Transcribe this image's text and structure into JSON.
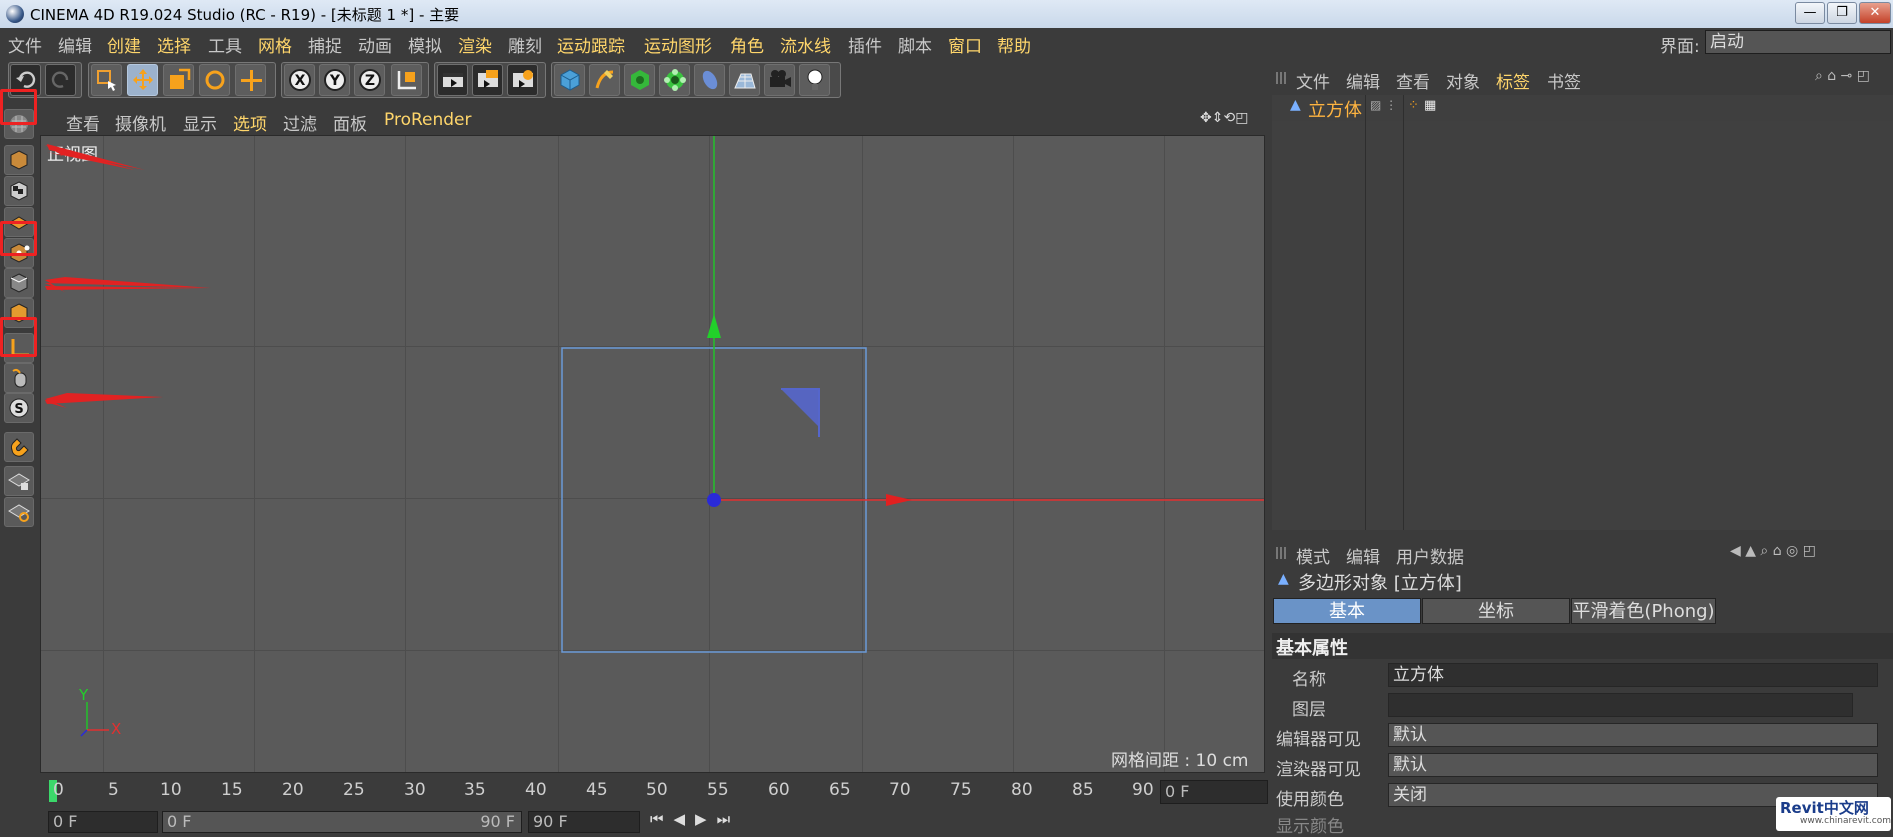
{
  "window": {
    "title": "CINEMA 4D R19.024 Studio (RC - R19) - [未标题 1 *] - 主要",
    "min": "—",
    "max": "❐",
    "close": "✕"
  },
  "menubar": {
    "items": [
      "文件",
      "编辑",
      "创建",
      "选择",
      "工具",
      "网格",
      "捕捉",
      "动画",
      "模拟",
      "渲染",
      "雕刻",
      "运动跟踪",
      "运动图形",
      "角色",
      "流水线",
      "插件",
      "脚本",
      "窗口",
      "帮助"
    ],
    "layout_label": "界面:",
    "layout_value": "启动"
  },
  "viewport": {
    "menu": [
      "查看",
      "摄像机",
      "显示",
      "选项",
      "过滤",
      "面板",
      "ProRender"
    ],
    "name": "正视图",
    "grid_spacing": "网格间距 : 10 cm",
    "axis_y": "Y",
    "axis_x": "X"
  },
  "timeline": {
    "ticks": [
      "0",
      "5",
      "10",
      "15",
      "20",
      "25",
      "30",
      "35",
      "40",
      "45",
      "50",
      "55",
      "60",
      "65",
      "70",
      "75",
      "80",
      "85",
      "90"
    ],
    "frame_field": "0 F"
  },
  "bottombar": {
    "start": "0 F",
    "range_start": "0 F",
    "range_end": "90 F",
    "end": "90 F"
  },
  "objmanager": {
    "menu": [
      "文件",
      "编辑",
      "查看",
      "对象",
      "标签",
      "书签"
    ],
    "object_name": "立方体"
  },
  "attrmanager": {
    "menu": [
      "模式",
      "编辑",
      "用户数据"
    ],
    "object_title": "多边形对象 [立方体]",
    "tabs": [
      "基本",
      "坐标",
      "平滑着色(Phong)"
    ],
    "section": "基本属性",
    "props": [
      {
        "label": "名称",
        "value": "立方体"
      },
      {
        "label": "图层",
        "value": ""
      },
      {
        "label": "编辑器可见",
        "value": "默认"
      },
      {
        "label": "渲染器可见",
        "value": "默认"
      },
      {
        "label": "使用颜色",
        "value": "关闭"
      },
      {
        "label": "显示颜色",
        "value": ""
      }
    ]
  },
  "watermark": {
    "brand": "Revit中文网",
    "url": "www.chinarevit.com"
  },
  "colors": {
    "accent": "#ffd66b",
    "x_axis": "#e23030",
    "y_axis": "#22c22a",
    "selection": "#6a9ad8",
    "annotation": "#e22222"
  }
}
